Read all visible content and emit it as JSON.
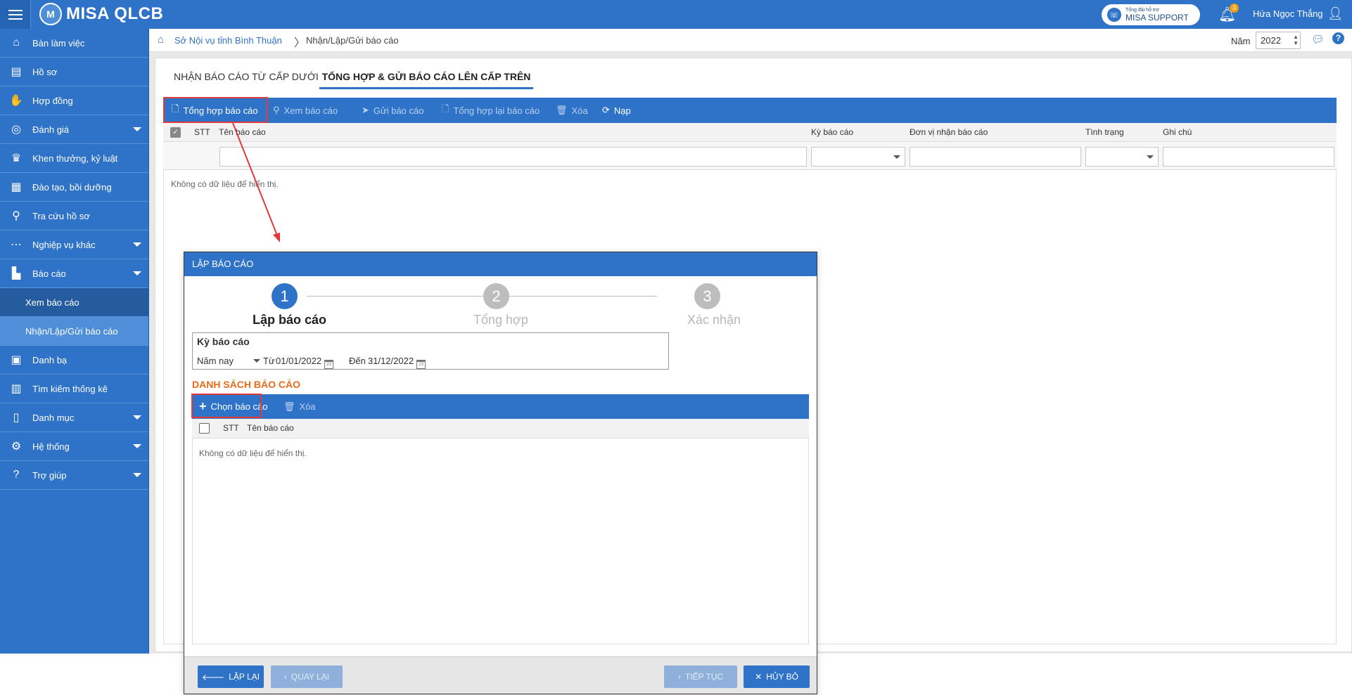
{
  "header": {
    "app_name": "MISA QLCB",
    "logo_mark": "M",
    "support_small": "Tổng đài hỗ trợ",
    "support_label": "MISA SUPPORT",
    "notification_count": "3",
    "user_name": "Hứa Ngọc Thắng"
  },
  "sidebar": {
    "items": [
      {
        "label": "Bàn làm việc",
        "icon": "home-icon"
      },
      {
        "label": "Hồ sơ",
        "icon": "id-card-icon"
      },
      {
        "label": "Hợp đồng",
        "icon": "handshake-icon"
      },
      {
        "label": "Đánh giá",
        "icon": "medal-icon"
      },
      {
        "label": "Khen thưởng, kỷ luật",
        "icon": "trophy-icon"
      },
      {
        "label": "Đào tạo, bồi dưỡng",
        "icon": "presentation-icon"
      },
      {
        "label": "Tra cứu hồ sơ",
        "icon": "search-icon"
      },
      {
        "label": "Nghiệp vụ khác",
        "icon": "more-icon"
      },
      {
        "label": "Báo cáo",
        "icon": "document-icon"
      },
      {
        "label": "Xem báo cáo"
      },
      {
        "label": "Nhận/Lập/Gửi báo cáo"
      },
      {
        "label": "Danh bạ",
        "icon": "contacts-icon"
      },
      {
        "label": "Tìm kiếm thống kê",
        "icon": "chart-icon"
      },
      {
        "label": "Danh mục",
        "icon": "book-icon"
      },
      {
        "label": "Hệ thống",
        "icon": "gear-icon"
      },
      {
        "label": "Trợ giúp",
        "icon": "help-icon"
      }
    ]
  },
  "breadcrumb": {
    "root": "Sở Nội vụ tỉnh Bình Thuận",
    "current": "Nhận/Lập/Gửi báo cáo",
    "year_label": "Năm",
    "year_value": "2022"
  },
  "tabs": [
    {
      "label": "NHẬN BÁO CÁO TỪ CẤP DƯỚI",
      "active": false
    },
    {
      "label": "TỔNG HỢP & GỬI BÁO CÁO LÊN CẤP TRÊN",
      "active": true
    }
  ],
  "toolbar": {
    "compile": "Tổng hợp báo cáo",
    "view": "Xem báo cáo",
    "send": "Gửi báo cáo",
    "recompile": "Tổng hợp lại báo cáo",
    "delete": "Xóa",
    "reload": "Nạp"
  },
  "grid": {
    "columns": [
      "STT",
      "Tên báo cáo",
      "Kỳ báo cáo",
      "Đơn vị nhận báo cáo",
      "Tình trạng",
      "Ghi chú"
    ],
    "empty": "Không có dữ liệu để hiển thị."
  },
  "dialog": {
    "title": "LẬP BÁO CÁO",
    "steps": [
      {
        "number": "1",
        "label": "Lập báo cáo",
        "active": true
      },
      {
        "number": "2",
        "label": "Tổng hợp",
        "active": false
      },
      {
        "number": "3",
        "label": "Xác nhận",
        "active": false
      }
    ],
    "period": {
      "title": "Kỳ báo cáo",
      "selected": "Năm nay",
      "from_label": "Từ",
      "from_date": "01/01/2022",
      "to_label": "Đến",
      "to_date": "31/12/2022"
    },
    "list_title": "DANH SÁCH BÁO CÁO",
    "choose_button": "Chọn báo cáo",
    "delete_button": "Xóa",
    "columns": [
      "STT",
      "Tên báo cáo"
    ],
    "empty": "Không có dữ liệu để hiển thị.",
    "footer": {
      "reset": "LẬP LẠI",
      "back": "QUAY LẠI",
      "next": "TIẾP TỤC",
      "cancel": "HỦY BỎ"
    }
  },
  "colors": {
    "primary": "#2f73c8",
    "highlight": "#e03a3a",
    "accent_orange": "#e86b1a"
  }
}
